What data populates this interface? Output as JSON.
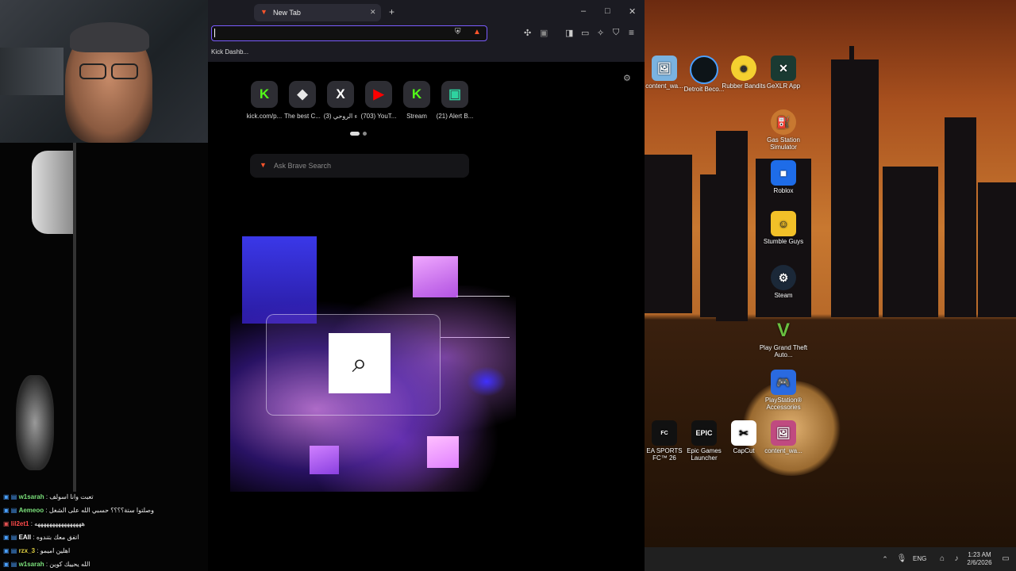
{
  "browser": {
    "tab_title": "New Tab",
    "new_tab": "+",
    "win_minimize": "–",
    "win_maximize": "□",
    "win_close": "✕",
    "bookmark": "Kick Dashb...",
    "search_placeholder": "Ask Brave Search",
    "tiles": [
      {
        "label": "kick.com/p...",
        "glyph": "K",
        "color": "#53fc18"
      },
      {
        "label": "The best C...",
        "glyph": "◆",
        "color": "#e8e8e8"
      },
      {
        "label": "(3) ء الروحي",
        "glyph": "X",
        "color": "#ffffff"
      },
      {
        "label": "(703) YouT...",
        "glyph": "▶",
        "color": "#ff0000"
      },
      {
        "label": "Stream",
        "glyph": "K",
        "color": "#53fc18"
      },
      {
        "label": "(21) Alert B...",
        "glyph": "▣",
        "color": "#2ed3a0"
      }
    ]
  },
  "desktop_icons": [
    {
      "label": "content_wa..."
    },
    {
      "label": "Detroit Beco..."
    },
    {
      "label": "Rubber Bandits"
    },
    {
      "label": "GeXLR App"
    },
    {
      "label": "Gas Station Simulator"
    },
    {
      "label": "Roblox"
    },
    {
      "label": "Stumble Guys"
    },
    {
      "label": "Steam"
    },
    {
      "label": "Play Grand Theft Auto..."
    },
    {
      "label": "PlayStation® Accessories"
    },
    {
      "label": "EA SPORTS FC™ 26"
    },
    {
      "label": "Epic Games Launcher"
    },
    {
      "label": "CapCut"
    },
    {
      "label": "content_wa..."
    }
  ],
  "chat": [
    {
      "name": "w1sarah",
      "msg": ": تعبت وانا اسولف"
    },
    {
      "name": "Aemeoo",
      "msg": ": وصلتوا ستة؟؟؟؟ حسبي الله على الشغل"
    },
    {
      "name": "lil2et1",
      "msg": ": ههههههههههههههههه"
    },
    {
      "name": "EAll",
      "msg": ": اتفق معك بتندوه"
    },
    {
      "name": "rzx_3",
      "msg": ": اهلين اميمو"
    },
    {
      "name": "w1sarah",
      "msg": ": الله يحييك كوين"
    }
  ],
  "taskbar": {
    "language": "ENG",
    "time": "1:23 AM",
    "date": "2/6/2026"
  }
}
